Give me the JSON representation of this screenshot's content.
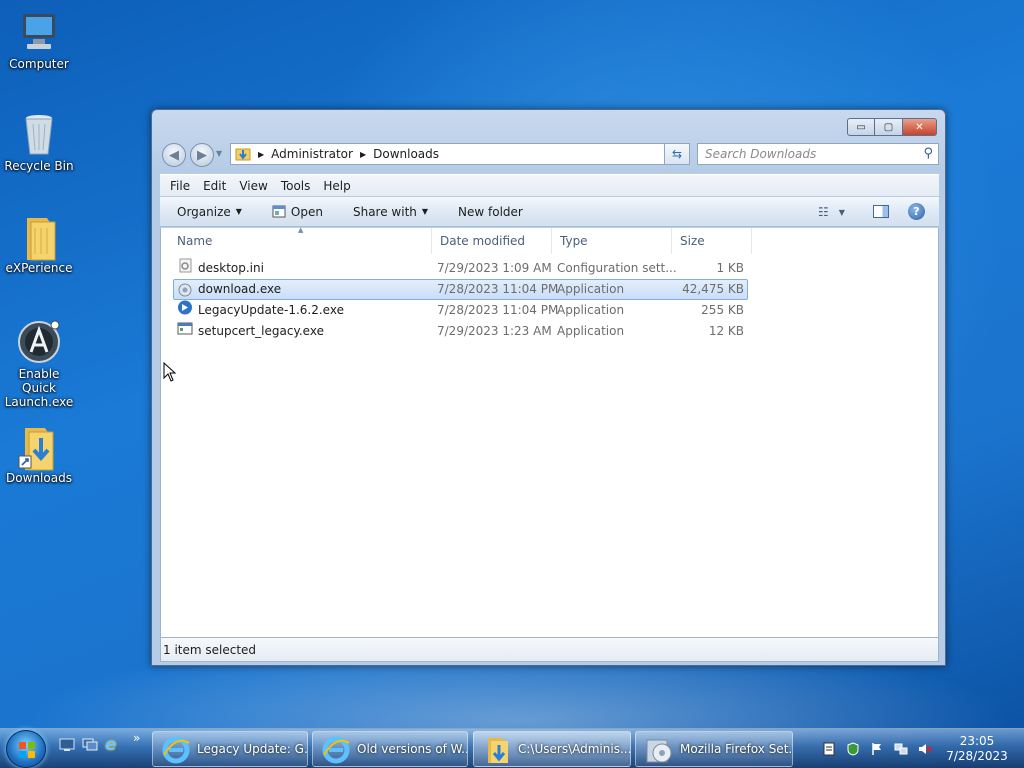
{
  "desktop": {
    "icons": [
      {
        "label": "Computer"
      },
      {
        "label": "Recycle Bin"
      },
      {
        "label": "eXPerience"
      },
      {
        "label": "Enable Quick Launch.exe"
      },
      {
        "label": "Downloads"
      }
    ]
  },
  "window": {
    "buttons": {
      "minimize": "▭",
      "maximize": "▢",
      "close": "✕"
    },
    "breadcrumb": [
      "Administrator",
      "Downloads"
    ],
    "search_placeholder": "Search Downloads",
    "menu": [
      "File",
      "Edit",
      "View",
      "Tools",
      "Help"
    ],
    "commands": {
      "organize": "Organize",
      "open": "Open",
      "share": "Share with",
      "new_folder": "New folder"
    },
    "columns": [
      "Name",
      "Date modified",
      "Type",
      "Size"
    ],
    "files": [
      {
        "name": "desktop.ini",
        "date": "7/29/2023 1:09 AM",
        "type": "Configuration sett...",
        "size": "1 KB"
      },
      {
        "name": "download.exe",
        "date": "7/28/2023 11:04 PM",
        "type": "Application",
        "size": "42,475 KB"
      },
      {
        "name": "LegacyUpdate-1.6.2.exe",
        "date": "7/28/2023 11:04 PM",
        "type": "Application",
        "size": "255 KB"
      },
      {
        "name": "setupcert_legacy.exe",
        "date": "7/29/2023 1:23 AM",
        "type": "Application",
        "size": "12 KB"
      }
    ],
    "status": "1 item selected"
  },
  "taskbar": {
    "tasks": [
      {
        "label": "Legacy Update: G..."
      },
      {
        "label": "Old versions of W..."
      },
      {
        "label": "C:\\Users\\Adminis..."
      },
      {
        "label": "Mozilla Firefox Set..."
      }
    ],
    "quicklaunch_more": "»",
    "clock": {
      "time": "23:05",
      "date": "7/28/2023"
    }
  },
  "colors": {
    "accent": "#1a7ad6",
    "selection": "#c9defa"
  }
}
